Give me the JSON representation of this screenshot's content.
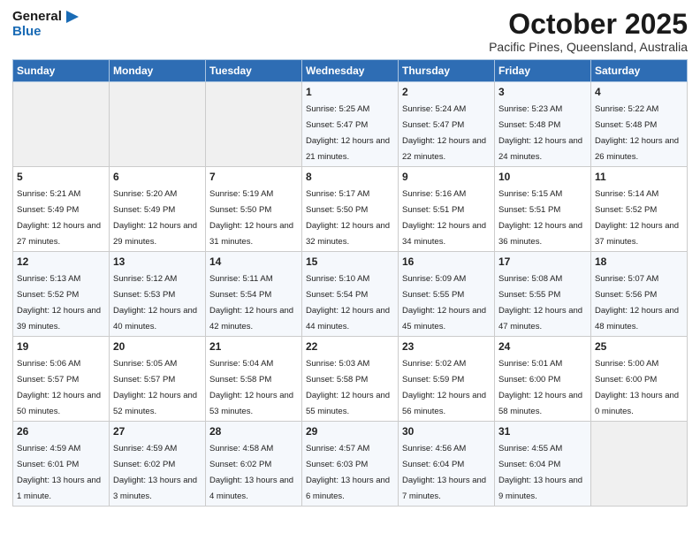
{
  "header": {
    "logo_line1": "General",
    "logo_line2": "Blue",
    "month": "October 2025",
    "location": "Pacific Pines, Queensland, Australia"
  },
  "days_of_week": [
    "Sunday",
    "Monday",
    "Tuesday",
    "Wednesday",
    "Thursday",
    "Friday",
    "Saturday"
  ],
  "weeks": [
    [
      {
        "day": "",
        "sunrise": "",
        "sunset": "",
        "daylight": ""
      },
      {
        "day": "",
        "sunrise": "",
        "sunset": "",
        "daylight": ""
      },
      {
        "day": "",
        "sunrise": "",
        "sunset": "",
        "daylight": ""
      },
      {
        "day": "1",
        "sunrise": "Sunrise: 5:25 AM",
        "sunset": "Sunset: 5:47 PM",
        "daylight": "Daylight: 12 hours and 21 minutes."
      },
      {
        "day": "2",
        "sunrise": "Sunrise: 5:24 AM",
        "sunset": "Sunset: 5:47 PM",
        "daylight": "Daylight: 12 hours and 22 minutes."
      },
      {
        "day": "3",
        "sunrise": "Sunrise: 5:23 AM",
        "sunset": "Sunset: 5:48 PM",
        "daylight": "Daylight: 12 hours and 24 minutes."
      },
      {
        "day": "4",
        "sunrise": "Sunrise: 5:22 AM",
        "sunset": "Sunset: 5:48 PM",
        "daylight": "Daylight: 12 hours and 26 minutes."
      }
    ],
    [
      {
        "day": "5",
        "sunrise": "Sunrise: 5:21 AM",
        "sunset": "Sunset: 5:49 PM",
        "daylight": "Daylight: 12 hours and 27 minutes."
      },
      {
        "day": "6",
        "sunrise": "Sunrise: 5:20 AM",
        "sunset": "Sunset: 5:49 PM",
        "daylight": "Daylight: 12 hours and 29 minutes."
      },
      {
        "day": "7",
        "sunrise": "Sunrise: 5:19 AM",
        "sunset": "Sunset: 5:50 PM",
        "daylight": "Daylight: 12 hours and 31 minutes."
      },
      {
        "day": "8",
        "sunrise": "Sunrise: 5:17 AM",
        "sunset": "Sunset: 5:50 PM",
        "daylight": "Daylight: 12 hours and 32 minutes."
      },
      {
        "day": "9",
        "sunrise": "Sunrise: 5:16 AM",
        "sunset": "Sunset: 5:51 PM",
        "daylight": "Daylight: 12 hours and 34 minutes."
      },
      {
        "day": "10",
        "sunrise": "Sunrise: 5:15 AM",
        "sunset": "Sunset: 5:51 PM",
        "daylight": "Daylight: 12 hours and 36 minutes."
      },
      {
        "day": "11",
        "sunrise": "Sunrise: 5:14 AM",
        "sunset": "Sunset: 5:52 PM",
        "daylight": "Daylight: 12 hours and 37 minutes."
      }
    ],
    [
      {
        "day": "12",
        "sunrise": "Sunrise: 5:13 AM",
        "sunset": "Sunset: 5:52 PM",
        "daylight": "Daylight: 12 hours and 39 minutes."
      },
      {
        "day": "13",
        "sunrise": "Sunrise: 5:12 AM",
        "sunset": "Sunset: 5:53 PM",
        "daylight": "Daylight: 12 hours and 40 minutes."
      },
      {
        "day": "14",
        "sunrise": "Sunrise: 5:11 AM",
        "sunset": "Sunset: 5:54 PM",
        "daylight": "Daylight: 12 hours and 42 minutes."
      },
      {
        "day": "15",
        "sunrise": "Sunrise: 5:10 AM",
        "sunset": "Sunset: 5:54 PM",
        "daylight": "Daylight: 12 hours and 44 minutes."
      },
      {
        "day": "16",
        "sunrise": "Sunrise: 5:09 AM",
        "sunset": "Sunset: 5:55 PM",
        "daylight": "Daylight: 12 hours and 45 minutes."
      },
      {
        "day": "17",
        "sunrise": "Sunrise: 5:08 AM",
        "sunset": "Sunset: 5:55 PM",
        "daylight": "Daylight: 12 hours and 47 minutes."
      },
      {
        "day": "18",
        "sunrise": "Sunrise: 5:07 AM",
        "sunset": "Sunset: 5:56 PM",
        "daylight": "Daylight: 12 hours and 48 minutes."
      }
    ],
    [
      {
        "day": "19",
        "sunrise": "Sunrise: 5:06 AM",
        "sunset": "Sunset: 5:57 PM",
        "daylight": "Daylight: 12 hours and 50 minutes."
      },
      {
        "day": "20",
        "sunrise": "Sunrise: 5:05 AM",
        "sunset": "Sunset: 5:57 PM",
        "daylight": "Daylight: 12 hours and 52 minutes."
      },
      {
        "day": "21",
        "sunrise": "Sunrise: 5:04 AM",
        "sunset": "Sunset: 5:58 PM",
        "daylight": "Daylight: 12 hours and 53 minutes."
      },
      {
        "day": "22",
        "sunrise": "Sunrise: 5:03 AM",
        "sunset": "Sunset: 5:58 PM",
        "daylight": "Daylight: 12 hours and 55 minutes."
      },
      {
        "day": "23",
        "sunrise": "Sunrise: 5:02 AM",
        "sunset": "Sunset: 5:59 PM",
        "daylight": "Daylight: 12 hours and 56 minutes."
      },
      {
        "day": "24",
        "sunrise": "Sunrise: 5:01 AM",
        "sunset": "Sunset: 6:00 PM",
        "daylight": "Daylight: 12 hours and 58 minutes."
      },
      {
        "day": "25",
        "sunrise": "Sunrise: 5:00 AM",
        "sunset": "Sunset: 6:00 PM",
        "daylight": "Daylight: 13 hours and 0 minutes."
      }
    ],
    [
      {
        "day": "26",
        "sunrise": "Sunrise: 4:59 AM",
        "sunset": "Sunset: 6:01 PM",
        "daylight": "Daylight: 13 hours and 1 minute."
      },
      {
        "day": "27",
        "sunrise": "Sunrise: 4:59 AM",
        "sunset": "Sunset: 6:02 PM",
        "daylight": "Daylight: 13 hours and 3 minutes."
      },
      {
        "day": "28",
        "sunrise": "Sunrise: 4:58 AM",
        "sunset": "Sunset: 6:02 PM",
        "daylight": "Daylight: 13 hours and 4 minutes."
      },
      {
        "day": "29",
        "sunrise": "Sunrise: 4:57 AM",
        "sunset": "Sunset: 6:03 PM",
        "daylight": "Daylight: 13 hours and 6 minutes."
      },
      {
        "day": "30",
        "sunrise": "Sunrise: 4:56 AM",
        "sunset": "Sunset: 6:04 PM",
        "daylight": "Daylight: 13 hours and 7 minutes."
      },
      {
        "day": "31",
        "sunrise": "Sunrise: 4:55 AM",
        "sunset": "Sunset: 6:04 PM",
        "daylight": "Daylight: 13 hours and 9 minutes."
      },
      {
        "day": "",
        "sunrise": "",
        "sunset": "",
        "daylight": ""
      }
    ]
  ]
}
